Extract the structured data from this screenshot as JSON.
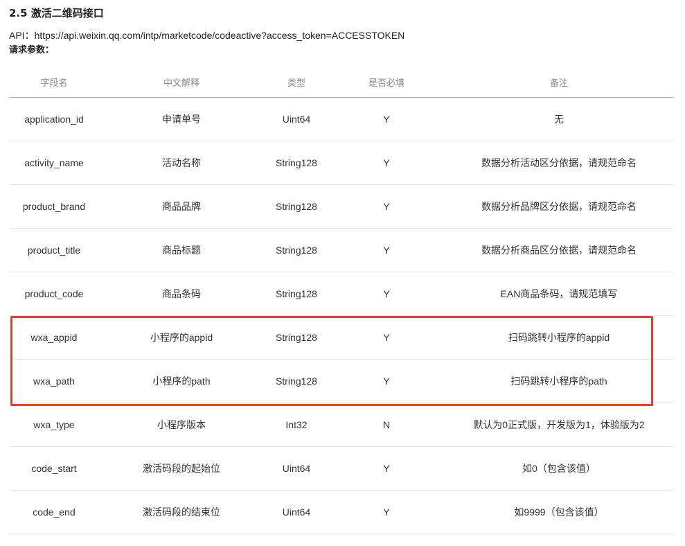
{
  "section": {
    "title": "2.5 激活二维码接口",
    "api_line": "API：https://api.weixin.qq.com/intp/marketcode/codeactive?access_token=ACCESSTOKEN",
    "params_label": "请求参数："
  },
  "table": {
    "headers": [
      "字段名",
      "中文解释",
      "类型",
      "是否必填",
      "备注"
    ],
    "rows": [
      [
        "application_id",
        "申请单号",
        "Uint64",
        "Y",
        "无"
      ],
      [
        "activity_name",
        "活动名称",
        "String128",
        "Y",
        "数据分析活动区分依据，请规范命名"
      ],
      [
        "product_brand",
        "商品品牌",
        "String128",
        "Y",
        "数据分析品牌区分依据，请规范命名"
      ],
      [
        "product_title",
        "商品标题",
        "String128",
        "Y",
        "数据分析商品区分依据，请规范命名"
      ],
      [
        "product_code",
        "商品条码",
        "String128",
        "Y",
        "EAN商品条码，请规范填写"
      ],
      [
        "wxa_appid",
        "小程序的appid",
        "String128",
        "Y",
        "扫码跳转小程序的appid"
      ],
      [
        "wxa_path",
        "小程序的path",
        "String128",
        "Y",
        "扫码跳转小程序的path"
      ],
      [
        "wxa_type",
        "小程序版本",
        "Int32",
        "N",
        "默认为0正式版，开发版为1，体验版为2"
      ],
      [
        "code_start",
        "激活码段的起始位",
        "Uint64",
        "Y",
        "如0（包含该值）"
      ],
      [
        "code_end",
        "激活码段的结束位",
        "Uint64",
        "Y",
        "如9999（包含该值）"
      ]
    ]
  },
  "highlight": {
    "color": "#e0412f",
    "rows": [
      "wxa_appid",
      "wxa_path"
    ]
  }
}
